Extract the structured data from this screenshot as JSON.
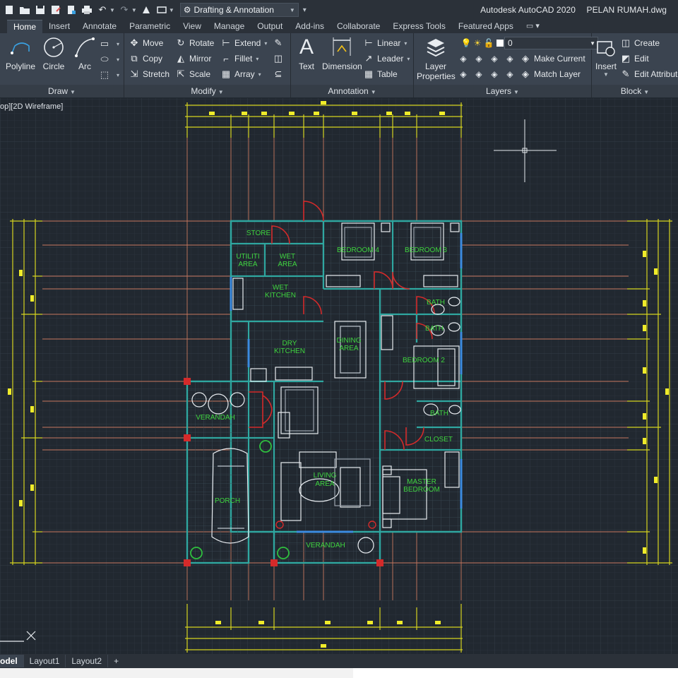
{
  "app": {
    "product": "Autodesk AutoCAD 2020",
    "file": "PELAN RUMAH.dwg",
    "workspace": "Drafting & Annotation"
  },
  "icons": {
    "new": "new-file-icon",
    "open": "open-folder-icon",
    "save": "save-icon",
    "saveas": "save-as-icon",
    "plot": "plot-printer-icon",
    "undo": "undo-icon",
    "redo": "redo-icon",
    "workspace": "gear-icon"
  },
  "tabs": [
    "Home",
    "Insert",
    "Annotate",
    "Parametric",
    "View",
    "Manage",
    "Output",
    "Add-ins",
    "Collaborate",
    "Express Tools",
    "Featured Apps"
  ],
  "ribbon": {
    "draw": {
      "label": "Draw",
      "polyline": "Polyline",
      "circle": "Circle",
      "arc": "Arc"
    },
    "modify": {
      "label": "Modify",
      "move": "Move",
      "rotate": "Rotate",
      "extend": "Extend",
      "copy": "Copy",
      "mirror": "Mirror",
      "fillet": "Fillet",
      "stretch": "Stretch",
      "scale": "Scale",
      "array": "Array"
    },
    "annotation": {
      "label": "Annotation",
      "text": "Text",
      "dimension": "Dimension",
      "linear": "Linear",
      "leader": "Leader",
      "table": "Table"
    },
    "layers": {
      "label": "Layers",
      "layer_properties": "Layer Properties",
      "current_layer": "0",
      "make_current": "Make Current",
      "match_layer": "Match Layer"
    },
    "block": {
      "label": "Block",
      "insert": "Insert",
      "create": "Create",
      "edit": "Edit",
      "edit_attributes": "Edit Attributes"
    }
  },
  "viewport": {
    "label": "op][2D Wireframe]"
  },
  "floorplan": {
    "rooms": {
      "store": "STORE",
      "utiliti_1": "UTILITI",
      "utiliti_2": "AREA",
      "wet_1": "WET",
      "wet_2": "AREA",
      "wetk_1": "WET",
      "wetk_2": "KITCHEN",
      "bed4": "BEDROOM 4",
      "bed3": "BEDROOM 3",
      "bath1": "BATH",
      "bath2": "BATH",
      "dryk_1": "DRY",
      "dryk_2": "KITCHEN",
      "dining_1": "DINING",
      "dining_2": "AREA",
      "bed2": "BEDROOM 2",
      "verandah_side": "VERANDAH",
      "bath3": "BATH",
      "closet": "CLOSET",
      "porch": "PORCH",
      "living_1": "LIVING",
      "living_2": "AREA",
      "master_1": "MASTER",
      "master_2": "BEDROOM",
      "verandah_front": "VERANDAH"
    }
  },
  "layout_tabs": [
    "odel",
    "Layout1",
    "Layout2",
    "+"
  ],
  "colors": {
    "wall": "#2fa7a0",
    "grid_line": "#c8785f",
    "dimension": "#d7d41f",
    "door": "#d42a2a",
    "label": "#3fd43f",
    "background": "#212830"
  }
}
